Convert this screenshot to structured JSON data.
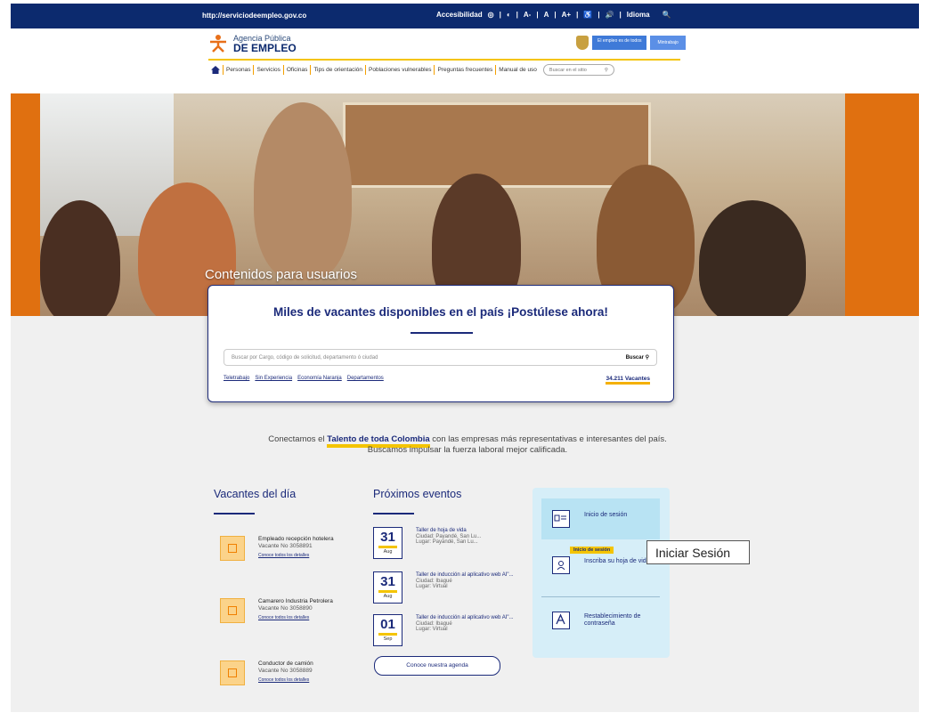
{
  "topbar": {
    "url": "http://serviciodeempleo.gov.co",
    "accessibility_label": "Accesibilidad",
    "controls": [
      "◎",
      "|",
      "◐",
      "|",
      "A-",
      "|",
      "A",
      "|",
      "A+",
      "|",
      "♿",
      "|",
      "🔊",
      "|",
      "Idioma",
      "🔍"
    ]
  },
  "header": {
    "logo_line1": "Agencia Pública",
    "logo_line2": "DE EMPLEO",
    "gov_pill1": "El empleo es de todos",
    "gov_pill2": "Mintrabajo"
  },
  "nav": {
    "items": [
      "Personas",
      "Servicios",
      "Oficinas",
      "Tips de orientación",
      "Poblaciones vulnerables",
      "Preguntas frecuentes",
      "Manual de uso"
    ],
    "search_placeholder": "Buscar en el sitio"
  },
  "hero": {
    "title": "Contenidos para usuarios"
  },
  "search_card": {
    "headline": "Miles de vacantes disponibles en el país ¡Postúlese ahora!",
    "placeholder": "Buscar por Cargo, código de solicitud, departamento ó ciudad",
    "button": "Buscar",
    "links": [
      "Teletrabajo",
      "Sin Experiencia",
      "Economía Naranja",
      "Departamentos"
    ],
    "count": "34.211 Vacantes"
  },
  "tagline": {
    "before": "Conectamos el ",
    "highlight": "Talento de toda Colombia",
    "after": " con las empresas más representativas e interesantes del país.",
    "line2": "Buscamos impulsar la fuerza laboral mejor calificada."
  },
  "vacancies": {
    "title": "Vacantes del día",
    "items": [
      {
        "title": "Empleado recepción hotelera",
        "no": "Vacante No 3058891",
        "link": "Conoce todos los detalles"
      },
      {
        "title": "Camarero Industria Petrolera",
        "no": "Vacante No 3058890",
        "link": "Conoce todos los detalles"
      },
      {
        "title": "Conductor de camión",
        "no": "Vacante No 3058889",
        "link": "Conoce todos los detalles"
      }
    ]
  },
  "events": {
    "title": "Próximos eventos",
    "items": [
      {
        "day": "31",
        "month": "Aug",
        "title": "Taller de hoja de vida",
        "city": "Ciudad: Payandé, San Lu...",
        "place": "Lugar: Payandé, San Lu..."
      },
      {
        "day": "31",
        "month": "Aug",
        "title": "Taller de inducción al aplicativo web AI\"...",
        "city": "Ciudad: Ibagué",
        "place": "Lugar: Virtual"
      },
      {
        "day": "01",
        "month": "Sep",
        "title": "Taller de inducción al aplicativo web AI\"...",
        "city": "Ciudad: Ibagué",
        "place": "Lugar: Virtual"
      }
    ],
    "agenda_button": "Conoce nuestra agenda"
  },
  "panel": {
    "items": [
      {
        "label": "Inicio de sesión"
      },
      {
        "label": "Inscriba su hoja de vida"
      },
      {
        "label": "Restablecimiento de contraseña"
      }
    ],
    "small_tip": "Inicio de sesión",
    "tooltip": "Iniciar Sesión"
  }
}
